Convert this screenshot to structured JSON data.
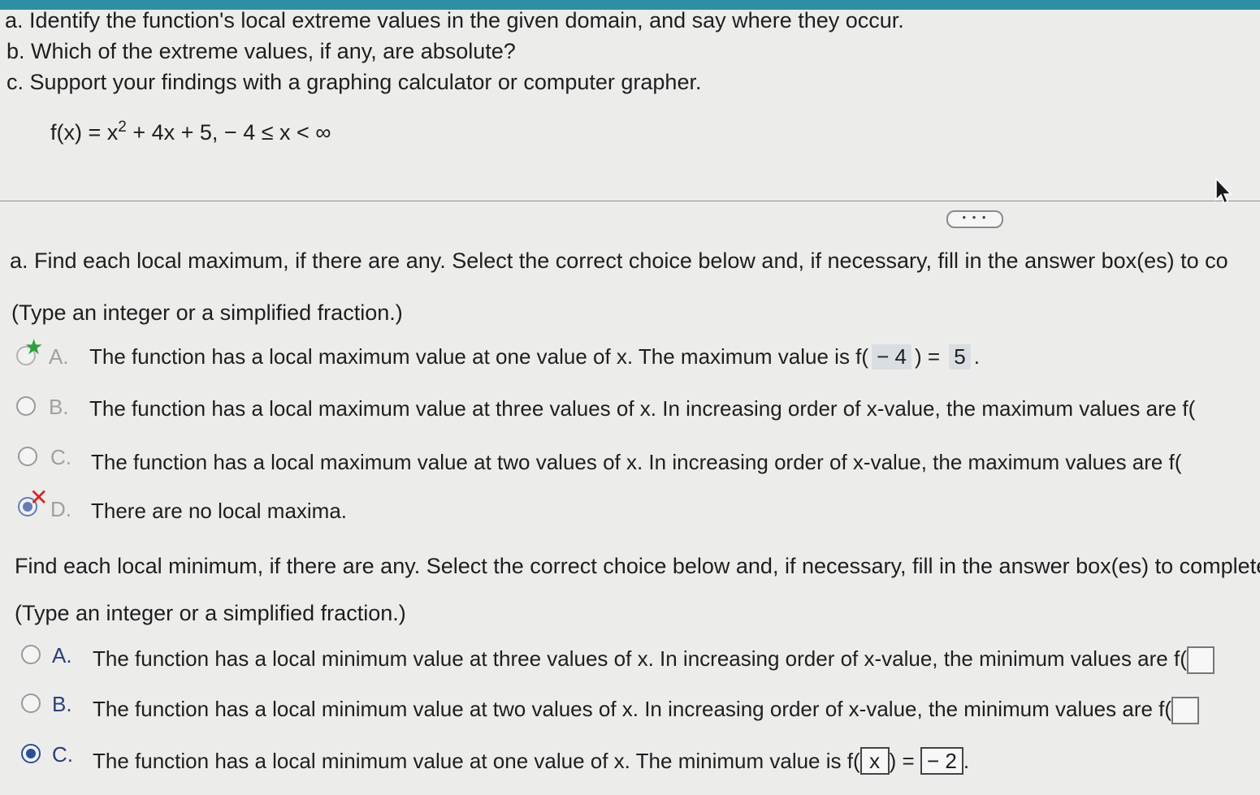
{
  "problem": {
    "line_a": "a. Identify the function's local extreme values in the given domain, and say where they occur.",
    "line_b": "b. Which of the extreme values, if any, are absolute?",
    "line_c": "c. Support your findings with a graphing calculator or computer grapher.",
    "formula_left": "f(x) = x",
    "formula_exp": "2",
    "formula_right": " + 4x + 5,  − 4 ≤ x < ∞"
  },
  "more_button": "• • •",
  "part_a": {
    "prompt": "a. Find each local maximum, if there are any. Select the correct choice below and, if necessary, fill in the answer box(es) to co",
    "hint": "(Type an integer or a simplified fraction.)",
    "choices": [
      {
        "letter": "A.",
        "text_before": "The function has a local maximum value at one value of x. The maximum value is f(",
        "box1": "− 4",
        "text_mid": ") =",
        "box2": "5",
        "text_after": "."
      },
      {
        "letter": "B.",
        "text": "The function has a local maximum value at three values of x. In increasing order of x-value, the maximum values are f("
      },
      {
        "letter": "C.",
        "text": "The function has a local maximum value at two values of x. In increasing order of x-value, the maximum values are f("
      },
      {
        "letter": "D.",
        "text": "There are no local maxima."
      }
    ]
  },
  "part_min": {
    "prompt": "Find each local minimum, if there are any. Select the correct choice below and, if necessary, fill in the answer box(es) to complete",
    "hint": "(Type an integer or a simplified fraction.)",
    "choices": [
      {
        "letter": "A.",
        "text": "The function has a local minimum value at three values of x. In increasing order of x-value, the minimum values are f("
      },
      {
        "letter": "B.",
        "text": "The function has a local minimum value at two values of x. In increasing order of x-value, the minimum values are f("
      },
      {
        "letter": "C.",
        "text_before": "The function has a local minimum value at one value of x. The minimum value is f(",
        "box1": "x",
        "text_mid": ") =",
        "box2": "− 2",
        "text_after": "."
      }
    ]
  },
  "colors": {
    "accent_bar": "#2e8fa3",
    "radio_selected": "#2a4f9e",
    "correct_star": "#2e9e3c",
    "wrong_x": "#d32424"
  }
}
